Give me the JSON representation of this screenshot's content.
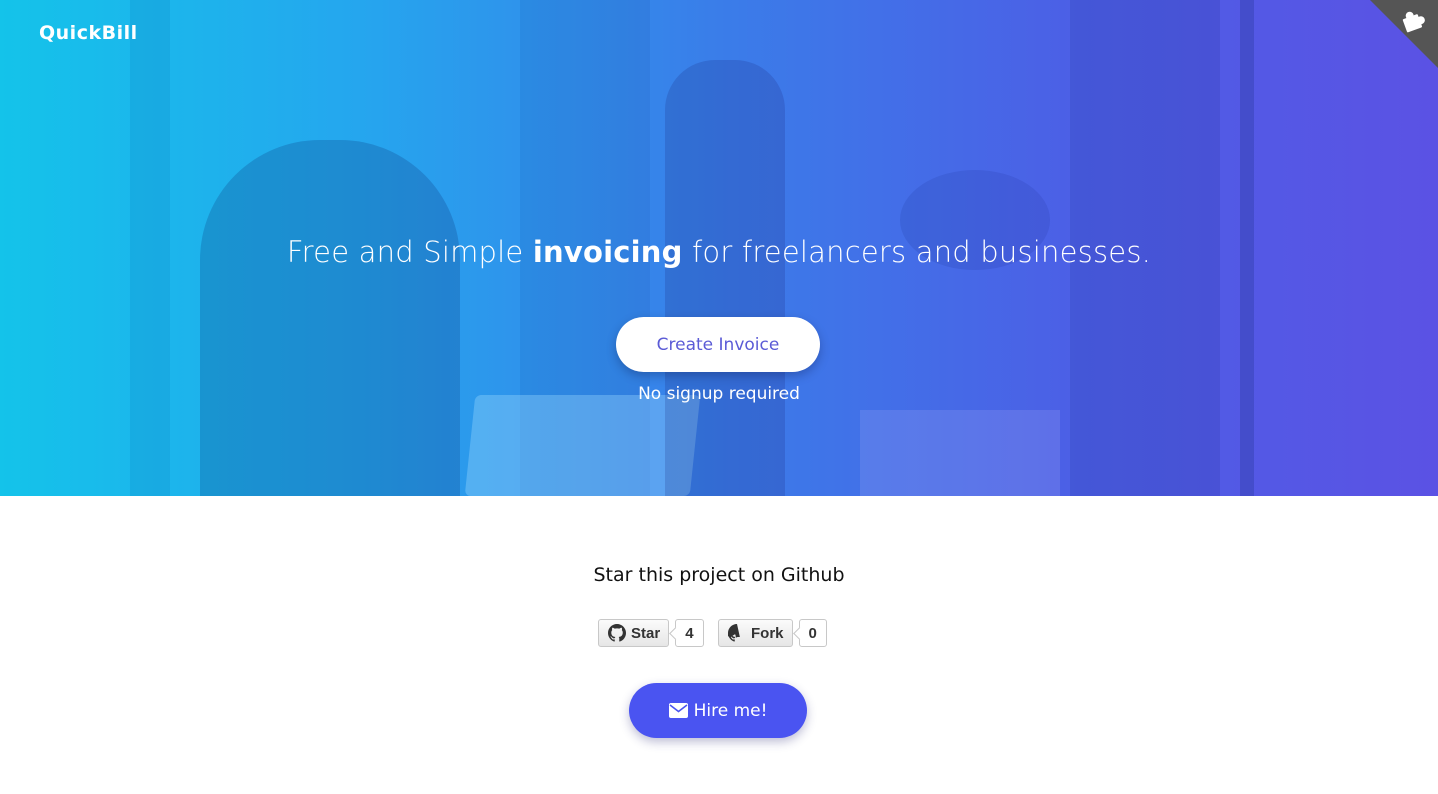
{
  "header": {
    "brand": "QuickBill",
    "corner_icon": "puzzle-icon"
  },
  "hero": {
    "headline_pre": "Free and Simple ",
    "headline_bold": "invoicing",
    "headline_post": " for freelancers and businesses.",
    "cta_label": "Create Invoice",
    "cta_note": "No signup required"
  },
  "github": {
    "title": "Star this project on Github",
    "star_label": "Star",
    "star_count": "4",
    "fork_label": "Fork",
    "fork_count": "0",
    "icon": "github-icon"
  },
  "hire": {
    "label": "Hire me!",
    "icon": "envelope-icon"
  },
  "colors": {
    "gradient_start": "#14c3ea",
    "gradient_end": "#5b52e4",
    "cta_text": "#5b5bd6",
    "hire_button": "#4a54f1"
  }
}
